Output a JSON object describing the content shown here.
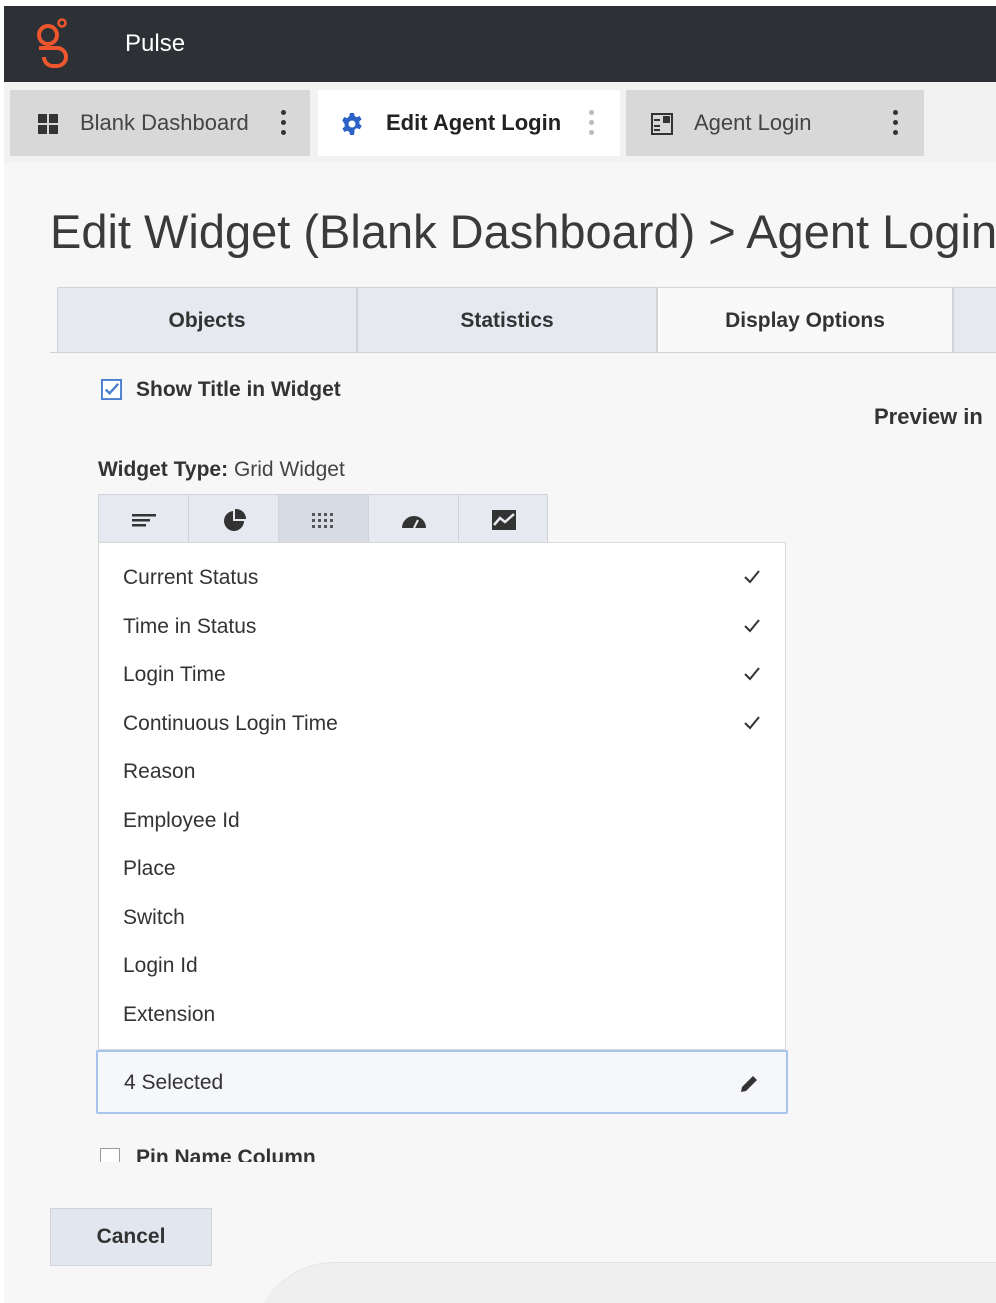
{
  "app": {
    "title": "Pulse"
  },
  "dashboard_tabs": [
    {
      "label": "Blank Dashboard",
      "icon": "grid-icon"
    },
    {
      "label": "Edit Agent Login",
      "icon": "gear-icon",
      "active": true
    },
    {
      "label": "Agent Login",
      "icon": "widget-icon"
    }
  ],
  "page": {
    "title": "Edit Widget (Blank Dashboard) > Agent Login"
  },
  "subtabs": [
    {
      "label": "Objects"
    },
    {
      "label": "Statistics"
    },
    {
      "label": "Display Options",
      "active": true
    }
  ],
  "display_options": {
    "show_title_label": "Show Title in Widget",
    "show_title_checked": true,
    "preview_label": "Preview in",
    "widget_type_label": "Widget Type:",
    "widget_type_value": "Grid Widget",
    "widget_types": [
      {
        "icon": "list-icon"
      },
      {
        "icon": "pie-chart-icon"
      },
      {
        "icon": "grid-dots-icon",
        "active": true
      },
      {
        "icon": "gauge-icon"
      },
      {
        "icon": "line-chart-icon"
      }
    ],
    "columns": [
      {
        "label": "Current Status",
        "checked": true
      },
      {
        "label": "Time in Status",
        "checked": true
      },
      {
        "label": "Login Time",
        "checked": true
      },
      {
        "label": "Continuous Login Time",
        "checked": true
      },
      {
        "label": "Reason",
        "checked": false
      },
      {
        "label": "Employee Id",
        "checked": false
      },
      {
        "label": "Place",
        "checked": false
      },
      {
        "label": "Switch",
        "checked": false
      },
      {
        "label": "Login Id",
        "checked": false
      },
      {
        "label": "Extension",
        "checked": false
      }
    ],
    "selected_summary": "4 Selected",
    "pin_name_label": "Pin Name Column"
  },
  "footer": {
    "cancel_label": "Cancel"
  },
  "colors": {
    "accent": "#4a7fd0",
    "topbar": "#2d3136",
    "logo": "#f0562d"
  }
}
